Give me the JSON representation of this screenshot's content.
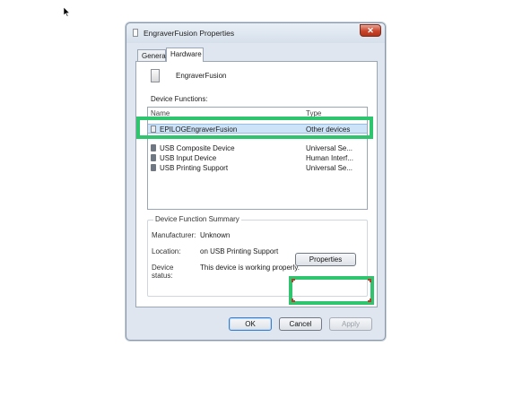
{
  "window": {
    "title": "EngraverFusion Properties",
    "close_label": "✕"
  },
  "tabs": [
    {
      "label": "General"
    },
    {
      "label": "Hardware"
    }
  ],
  "hardware": {
    "device_name": "EngraverFusion",
    "functions_label": "Device Functions:",
    "columns": {
      "name": "Name",
      "type": "Type"
    },
    "rows": [
      {
        "name": "EPILOGEngraverFusion",
        "type": "Other devices",
        "icon": "device-icon",
        "selected": true
      },
      {
        "name": "USB Composite Device",
        "type": "Universal Se...",
        "icon": "usb-icon"
      },
      {
        "name": "USB Input Device",
        "type": "Human Interf...",
        "icon": "usb-icon"
      },
      {
        "name": "USB Printing Support",
        "type": "Universal Se...",
        "icon": "usb-icon"
      }
    ],
    "summary": {
      "title": "Device Function Summary",
      "manufacturer_label": "Manufacturer:",
      "manufacturer": "Unknown",
      "location_label": "Location:",
      "location": "on USB Printing Support",
      "status_label": "Device status:",
      "status": "This device is working properly."
    },
    "properties_label": "Properties"
  },
  "footer": {
    "ok_label": "OK",
    "cancel_label": "Cancel",
    "apply_label": "Apply"
  },
  "colors": {
    "highlight": "#2fc46e",
    "selection": "#cde3f7"
  }
}
